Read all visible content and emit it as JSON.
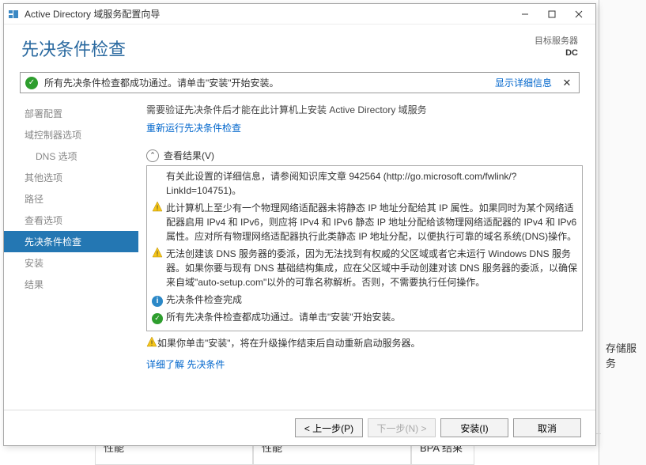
{
  "titlebar": {
    "title": "Active Directory 域服务配置向导"
  },
  "header": {
    "title": "先决条件检查",
    "target_label": "目标服务器",
    "target_server": "DC"
  },
  "notice": {
    "text": "所有先决条件检查都成功通过。请单击\"安装\"开始安装。",
    "link": "显示详细信息"
  },
  "sidebar": {
    "items": [
      {
        "label": "部署配置",
        "active": false,
        "indent": false
      },
      {
        "label": "域控制器选项",
        "active": false,
        "indent": false
      },
      {
        "label": "DNS 选项",
        "active": false,
        "indent": true
      },
      {
        "label": "其他选项",
        "active": false,
        "indent": false
      },
      {
        "label": "路径",
        "active": false,
        "indent": false
      },
      {
        "label": "查看选项",
        "active": false,
        "indent": false
      },
      {
        "label": "先决条件检查",
        "active": true,
        "indent": false
      },
      {
        "label": "安装",
        "active": false,
        "indent": false
      },
      {
        "label": "结果",
        "active": false,
        "indent": false
      }
    ]
  },
  "main": {
    "intro": "需要验证先决条件后才能在此计算机上安装 Active Directory 域服务",
    "rerun": "重新运行先决条件检查",
    "results_head": "查看结果(V)",
    "results": [
      {
        "icon": "none",
        "text": "有关此设置的详细信息，请参阅知识库文章 942564 (http://go.microsoft.com/fwlink/?LinkId=104751)。"
      },
      {
        "icon": "warn",
        "text": "此计算机上至少有一个物理网络适配器未将静态 IP 地址分配给其 IP 属性。如果同时为某个网络适配器启用 IPv4 和 IPv6，则应将 IPv4 和 IPv6 静态 IP 地址分配给该物理网络适配器的 IPv4 和 IPv6 属性。应对所有物理网络适配器执行此类静态 IP 地址分配，以便执行可靠的域名系统(DNS)操作。"
      },
      {
        "icon": "warn",
        "text": "无法创建该 DNS 服务器的委派，因为无法找到有权威的父区域或者它未运行 Windows DNS 服务器。如果你要与现有 DNS 基础结构集成，应在父区域中手动创建对该 DNS 服务器的委派，以确保来自域\"auto-setup.com\"以外的可靠名称解析。否则，不需要执行任何操作。"
      },
      {
        "icon": "info",
        "text": "先决条件检查完成"
      },
      {
        "icon": "ok",
        "text": "所有先决条件检查都成功通过。请单击\"安装\"开始安装。"
      }
    ],
    "warnline": "如果你单击\"安装\"，将在升级操作结束后自动重新启动服务器。",
    "learn_prefix": "详细了解 ",
    "learn_link": "先决条件"
  },
  "footer": {
    "prev": "< 上一步(P)",
    "next": "下一步(N) >",
    "install": "安装(I)",
    "cancel": "取消"
  },
  "bg": {
    "stub": "存储服务",
    "cell1": "性能",
    "cell2": "性能",
    "cell3": "BPA 结果"
  }
}
